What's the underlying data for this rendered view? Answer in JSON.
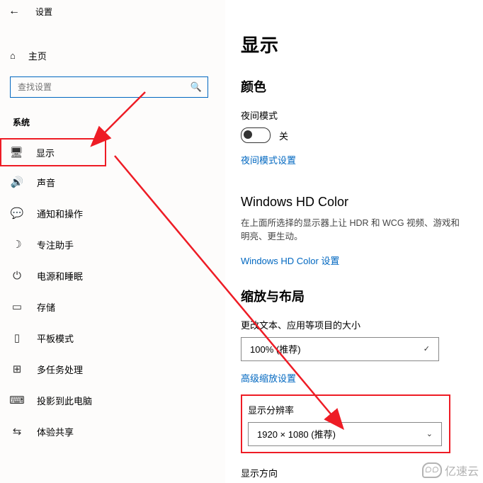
{
  "header": {
    "title": "设置"
  },
  "home": "主页",
  "search": {
    "placeholder": "查找设置"
  },
  "section": "系统",
  "nav": [
    {
      "label": "显示"
    },
    {
      "label": "声音"
    },
    {
      "label": "通知和操作"
    },
    {
      "label": "专注助手"
    },
    {
      "label": "电源和睡眠"
    },
    {
      "label": "存储"
    },
    {
      "label": "平板模式"
    },
    {
      "label": "多任务处理"
    },
    {
      "label": "投影到此电脑"
    },
    {
      "label": "体验共享"
    }
  ],
  "page": {
    "title": "显示",
    "color_heading": "颜色",
    "night_label": "夜间模式",
    "toggle_state": "关",
    "night_link": "夜间模式设置",
    "hd_heading": "Windows HD Color",
    "hd_desc": "在上面所选择的显示器上让 HDR 和 WCG 视频、游戏和明亮、更生动。",
    "hd_link": "Windows HD Color 设置",
    "scale_heading": "缩放与布局",
    "scale_label": "更改文本、应用等项目的大小",
    "scale_value": "100% (推荐)",
    "scale_link": "高级缩放设置",
    "res_label": "显示分辨率",
    "res_value": "1920 × 1080 (推荐)",
    "orient_label": "显示方向"
  },
  "watermark": "亿速云"
}
